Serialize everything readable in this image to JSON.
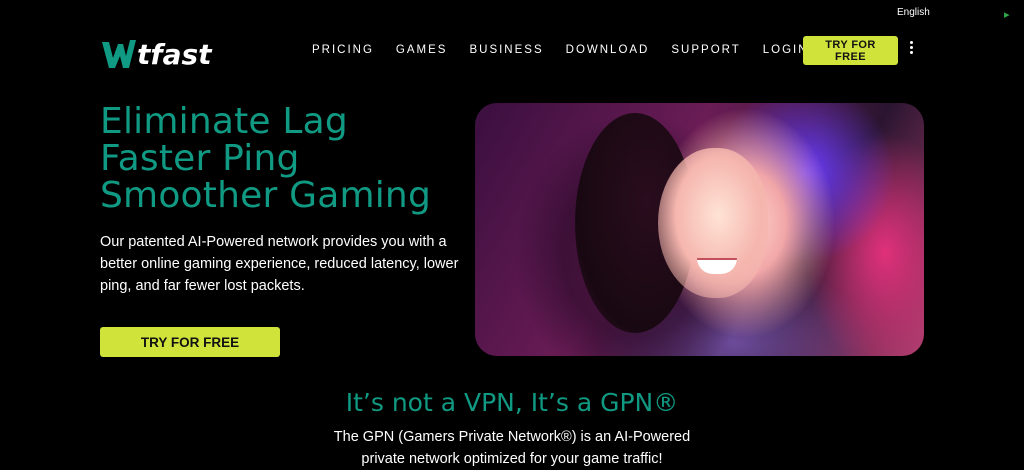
{
  "language": {
    "label": "English"
  },
  "brand": {
    "name": "wtfast"
  },
  "nav": {
    "items": [
      "PRICING",
      "GAMES",
      "BUSINESS",
      "DOWNLOAD",
      "SUPPORT",
      "LOGIN"
    ],
    "cta_label": "TRY FOR FREE"
  },
  "hero": {
    "headline": [
      "Eliminate Lag",
      "Faster Ping",
      "Smoother Gaming"
    ],
    "description": "Our patented AI-Powered network provides you with a better online gaming experience, reduced latency, lower ping, and far fewer lost packets.",
    "cta_label": "TRY FOR FREE"
  },
  "section": {
    "title": "It’s not a VPN, It’s a GPN®",
    "description": "The GPN (Gamers Private Network®) is an AI-Powered private network optimized for your game traffic!"
  },
  "colors": {
    "accent_teal": "#109a83",
    "cta_lime": "#cfe33a",
    "background": "#000000"
  }
}
